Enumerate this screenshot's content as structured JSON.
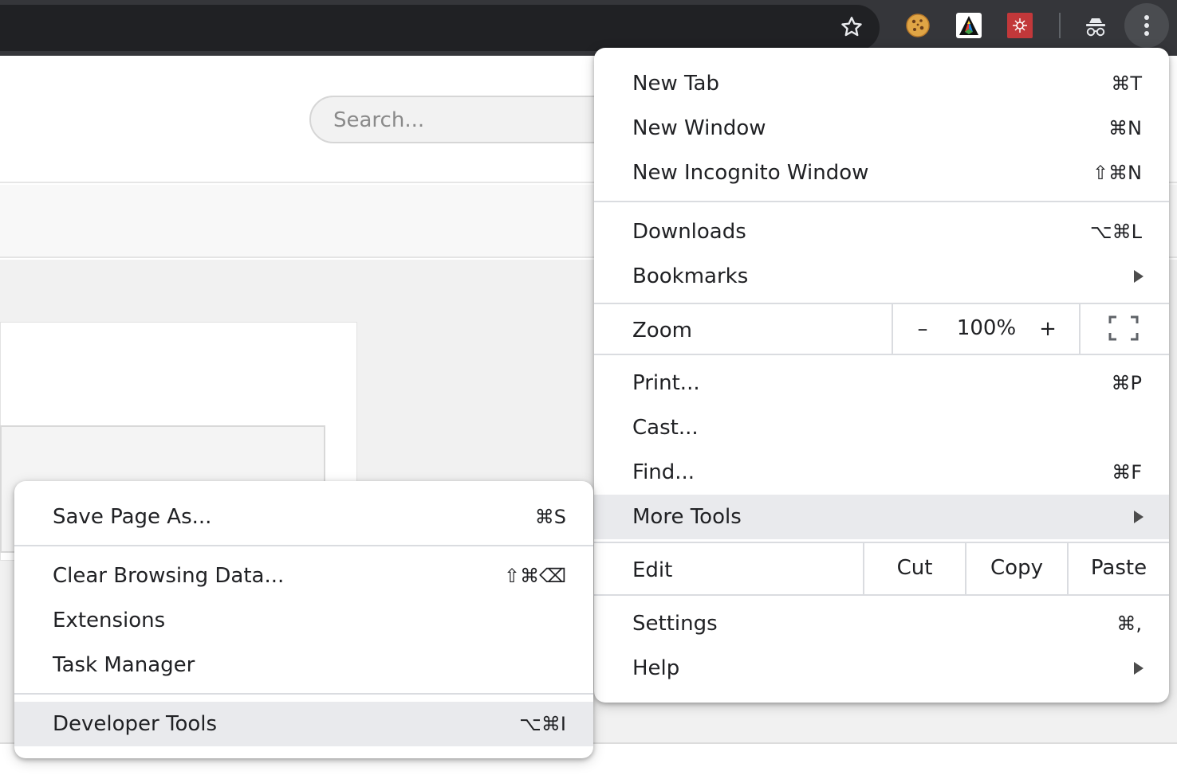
{
  "page": {
    "search_placeholder": "Search..."
  },
  "toolbar": {
    "icons": [
      "star-icon",
      "cookie-extension-icon",
      "rainbow-extension-icon",
      "red-extension-icon",
      "incognito-icon",
      "more-vertical-icon"
    ]
  },
  "main_menu": {
    "new_tab": {
      "label": "New Tab",
      "shortcut": "⌘T"
    },
    "new_window": {
      "label": "New Window",
      "shortcut": "⌘N"
    },
    "new_incognito": {
      "label": "New Incognito Window",
      "shortcut": "⇧⌘N"
    },
    "downloads": {
      "label": "Downloads",
      "shortcut": "⌥⌘L"
    },
    "bookmarks": {
      "label": "Bookmarks"
    },
    "zoom": {
      "label": "Zoom",
      "minus": "–",
      "value": "100%",
      "plus": "+"
    },
    "print": {
      "label": "Print...",
      "shortcut": "⌘P"
    },
    "cast": {
      "label": "Cast..."
    },
    "find": {
      "label": "Find...",
      "shortcut": "⌘F"
    },
    "more_tools": {
      "label": "More Tools"
    },
    "edit": {
      "label": "Edit",
      "cut": "Cut",
      "copy": "Copy",
      "paste": "Paste"
    },
    "settings": {
      "label": "Settings",
      "shortcut": "⌘,"
    },
    "help": {
      "label": "Help"
    }
  },
  "sub_menu": {
    "save_page": {
      "label": "Save Page As...",
      "shortcut": "⌘S"
    },
    "clear_data": {
      "label": "Clear Browsing Data...",
      "shortcut": "⇧⌘⌫"
    },
    "extensions": {
      "label": "Extensions"
    },
    "task_manager": {
      "label": "Task Manager"
    },
    "developer_tools": {
      "label": "Developer Tools",
      "shortcut": "⌥⌘I"
    }
  },
  "colors": {
    "toolbar": "#35363a",
    "highlight": "#e9eaed",
    "divider": "#dadce0"
  }
}
